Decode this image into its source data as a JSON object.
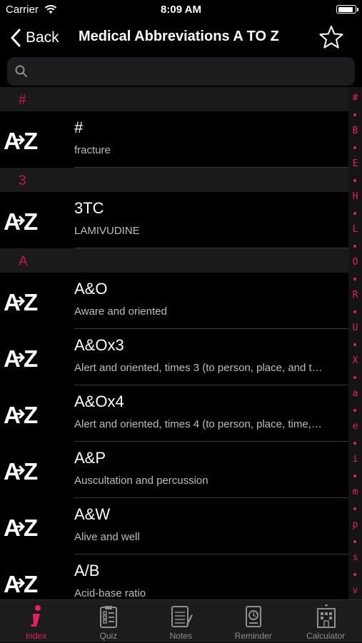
{
  "status": {
    "carrier": "Carrier",
    "time": "8:09 AM"
  },
  "nav": {
    "back_label": "Back",
    "title": "Medical Abbreviations A TO Z"
  },
  "search": {
    "placeholder": "",
    "value": ""
  },
  "colors": {
    "accent": "#e91e63",
    "section_text": "#c2185b",
    "background": "#000000"
  },
  "sections": [
    {
      "header": "#",
      "rows": [
        {
          "abbr": "#",
          "desc": "fracture"
        }
      ]
    },
    {
      "header": "3",
      "rows": [
        {
          "abbr": "3TC",
          "desc": "LAMIVUDINE"
        }
      ]
    },
    {
      "header": "A",
      "rows": [
        {
          "abbr": "A&O",
          "desc": "Aware and oriented"
        },
        {
          "abbr": "A&Ox3",
          "desc": "Alert and oriented, times 3 (to person, place, and t…"
        },
        {
          "abbr": "A&Ox4",
          "desc": "Alert and oriented, times 4 (to person, place, time,…"
        },
        {
          "abbr": "A&P",
          "desc": "Auscultation and percussion"
        },
        {
          "abbr": "A&W",
          "desc": "Alive and well"
        },
        {
          "abbr": "A/B",
          "desc": "Acid-base ratio"
        }
      ]
    }
  ],
  "row_icon": "az-icon",
  "index_letters": [
    "#",
    "B",
    "E",
    "H",
    "L",
    "O",
    "R",
    "U",
    "X",
    "a",
    "e",
    "i",
    "m",
    "p",
    "s",
    "v"
  ],
  "tabs": [
    {
      "label": "Index",
      "icon": "info-icon",
      "active": true
    },
    {
      "label": "Quiz",
      "icon": "clipboard-icon",
      "active": false
    },
    {
      "label": "Notes",
      "icon": "notes-icon",
      "active": false
    },
    {
      "label": "Reminder",
      "icon": "reminder-icon",
      "active": false
    },
    {
      "label": "Calculator",
      "icon": "hospital-icon",
      "active": false
    }
  ]
}
